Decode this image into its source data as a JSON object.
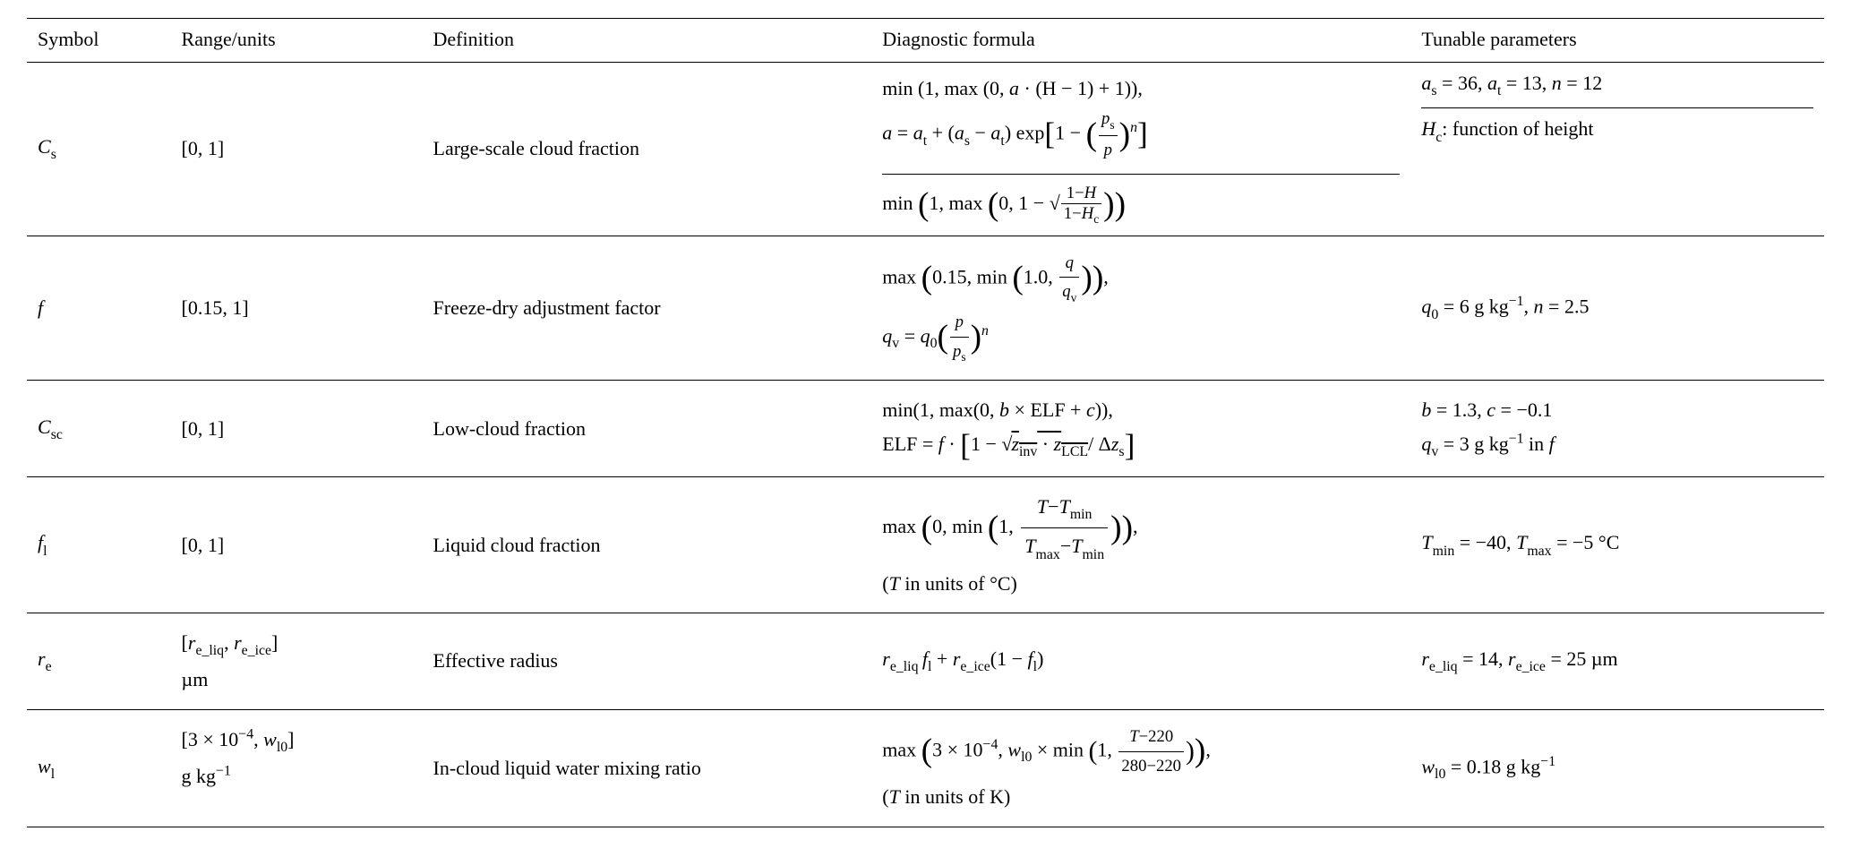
{
  "headers": {
    "symbol": "Symbol",
    "range": "Range/units",
    "definition": "Definition",
    "formula": "Diagnostic formula",
    "tunable": "Tunable parameters"
  },
  "rows": {
    "Cs": {
      "symbol_var": "C",
      "symbol_sub": "s",
      "range": "[0, 1]",
      "definition": "Large-scale cloud fraction",
      "formula1_line1_prefix": "min (1, max (0, ",
      "formula1_line1_body": " · (H − 1) + 1)),",
      "formula1_a": "a",
      "formula1_line2_eq": " = ",
      "formula1_at": "a",
      "formula1_at_sub": "t",
      "formula1_plus": " + (",
      "formula1_as": "a",
      "formula1_as_sub": "s",
      "formula1_minus": " − ",
      "formula1_exp": ") exp",
      "formula1_one_minus": "1 − ",
      "formula1_ps": "p",
      "formula1_ps_sub": "s",
      "formula1_p": "p",
      "formula1_n": "n",
      "tunable1_as": "a",
      "tunable1_as_sub": "s",
      "tunable1_as_val": " = 36, ",
      "tunable1_at": "a",
      "tunable1_at_sub": "t",
      "tunable1_at_val": " = 13, ",
      "tunable1_n": "n",
      "tunable1_n_val": " = 12",
      "formula2_prefix": "min ",
      "formula2_body1": "1, max ",
      "formula2_body2": "0, 1 − ",
      "formula2_frac_num_pre": "1−",
      "formula2_frac_num_H": "H",
      "formula2_frac_den_pre": "1−",
      "formula2_frac_den_H": "H",
      "formula2_frac_den_sub": "c",
      "tunable2_H": "H",
      "tunable2_sub": "c",
      "tunable2_text": ": function of height"
    },
    "f": {
      "symbol": "f",
      "range": "[0.15, 1]",
      "definition": "Freeze-dry adjustment factor",
      "line1_pre": "max ",
      "line1_body": "0.15, min ",
      "line1_inner": "1.0, ",
      "line1_q": "q",
      "line1_qv": "q",
      "line1_qv_sub": "v",
      "line2_qv": "q",
      "line2_qv_sub": "v",
      "line2_eq": " = ",
      "line2_q0": "q",
      "line2_q0_sub": "0",
      "line2_p": "p",
      "line2_ps": "p",
      "line2_ps_sub": "s",
      "line2_n": "n",
      "tun_q0": "q",
      "tun_q0_sub": "0",
      "tun_q0_val": " = 6 g kg",
      "tun_q0_exp": "−1",
      "tun_sep": ", ",
      "tun_n": "n",
      "tun_n_val": " = 2.5"
    },
    "Csc": {
      "symbol_var": "C",
      "symbol_sub": "sc",
      "range": "[0, 1]",
      "definition": "Low-cloud fraction",
      "line1": "min(1, max(0,  ",
      "line1_b": "b",
      "line1_mid": " × ELF + ",
      "line1_c": "c",
      "line1_end": ")),",
      "line2_pre": "ELF = ",
      "line2_f": "f",
      "line2_dot": " · ",
      "line2_one_minus": "1 − ",
      "line2_zinv": "z",
      "line2_zinv_sub": "inv",
      "line2_cdot": " · ",
      "line2_zlcl": "z",
      "line2_zlcl_sub": "LCL",
      "line2_slash": "/ Δ",
      "line2_zs": "z",
      "line2_zs_sub": "s",
      "tun_line1_b": "b",
      "tun_line1_bv": " = 1.3, ",
      "tun_line1_c": "c",
      "tun_line1_cv": " = −0.1",
      "tun_line2_qv": "q",
      "tun_line2_qv_sub": "v",
      "tun_line2_val": " = 3 g kg",
      "tun_line2_exp": "−1",
      "tun_line2_in": " in ",
      "tun_line2_f": "f"
    },
    "fl": {
      "symbol_var": "f",
      "symbol_sub": "l",
      "range": "[0, 1]",
      "definition": "Liquid cloud fraction",
      "line1_pre": "max ",
      "line1_body1": "0, min ",
      "line1_body2": "1, ",
      "frac_num_T": "T",
      "frac_num_minus": "−",
      "frac_num_Tmin": "T",
      "frac_num_Tmin_sub": "min",
      "frac_den_Tmax": "T",
      "frac_den_Tmax_sub": "max",
      "frac_den_minus": "−",
      "frac_den_Tmin": "T",
      "frac_den_Tmin_sub": "min",
      "line2_pre": "(",
      "line2_T": "T",
      "line2_rest": " in units of °C)",
      "tun_Tmin": "T",
      "tun_Tmin_sub": "min",
      "tun_Tmin_val": " = −40, ",
      "tun_Tmax": "T",
      "tun_Tmax_sub": "max",
      "tun_Tmax_val": " = −5 °C"
    },
    "re": {
      "symbol_var": "r",
      "symbol_sub": "e",
      "range_open": "[",
      "range_rliq": "r",
      "range_rliq_sub": "e_liq",
      "range_comma": ", ",
      "range_rice": "r",
      "range_rice_sub": "e_ice",
      "range_close": "]",
      "range_unit": "µm",
      "definition": "Effective radius",
      "form_rliq": "r",
      "form_rliq_sub": "e_liq",
      "form_fl": "f",
      "form_fl_sub": "l",
      "form_plus": " + ",
      "form_rice": "r",
      "form_rice_sub": "e_ice",
      "form_open": "(1 − ",
      "form_fl2": "f",
      "form_fl2_sub": "l",
      "form_close": ")",
      "tun_rliq": "r",
      "tun_rliq_sub": "e_liq",
      "tun_rliq_val": " = 14, ",
      "tun_rice": "r",
      "tun_rice_sub": "e_ice",
      "tun_rice_val": " = 25 µm"
    },
    "wl": {
      "symbol_var": "w",
      "symbol_sub": "l",
      "range_open": "[3 × 10",
      "range_exp": "−4",
      "range_comma": ", ",
      "range_wl0": "w",
      "range_wl0_sub": "l0",
      "range_close": "]",
      "range_unit": "g kg",
      "range_unit_exp": "−1",
      "definition": "In-cloud liquid water mixing ratio",
      "line1_pre": "max ",
      "line1_body1": "3 × 10",
      "line1_exp": "−4",
      "line1_comma": ", ",
      "line1_wl0": "w",
      "line1_wl0_sub": "l0",
      "line1_times": " × min ",
      "line1_inner1": "1, ",
      "frac_num_T": "T",
      "frac_num_rest": "−220",
      "frac_den": "280−220",
      "line1_end": ",",
      "line2_pre": "(",
      "line2_T": "T",
      "line2_rest": " in units of K)",
      "tun_wl0": "w",
      "tun_wl0_sub": "l0",
      "tun_wl0_val": " = 0.18 g kg",
      "tun_wl0_exp": "−1"
    }
  }
}
